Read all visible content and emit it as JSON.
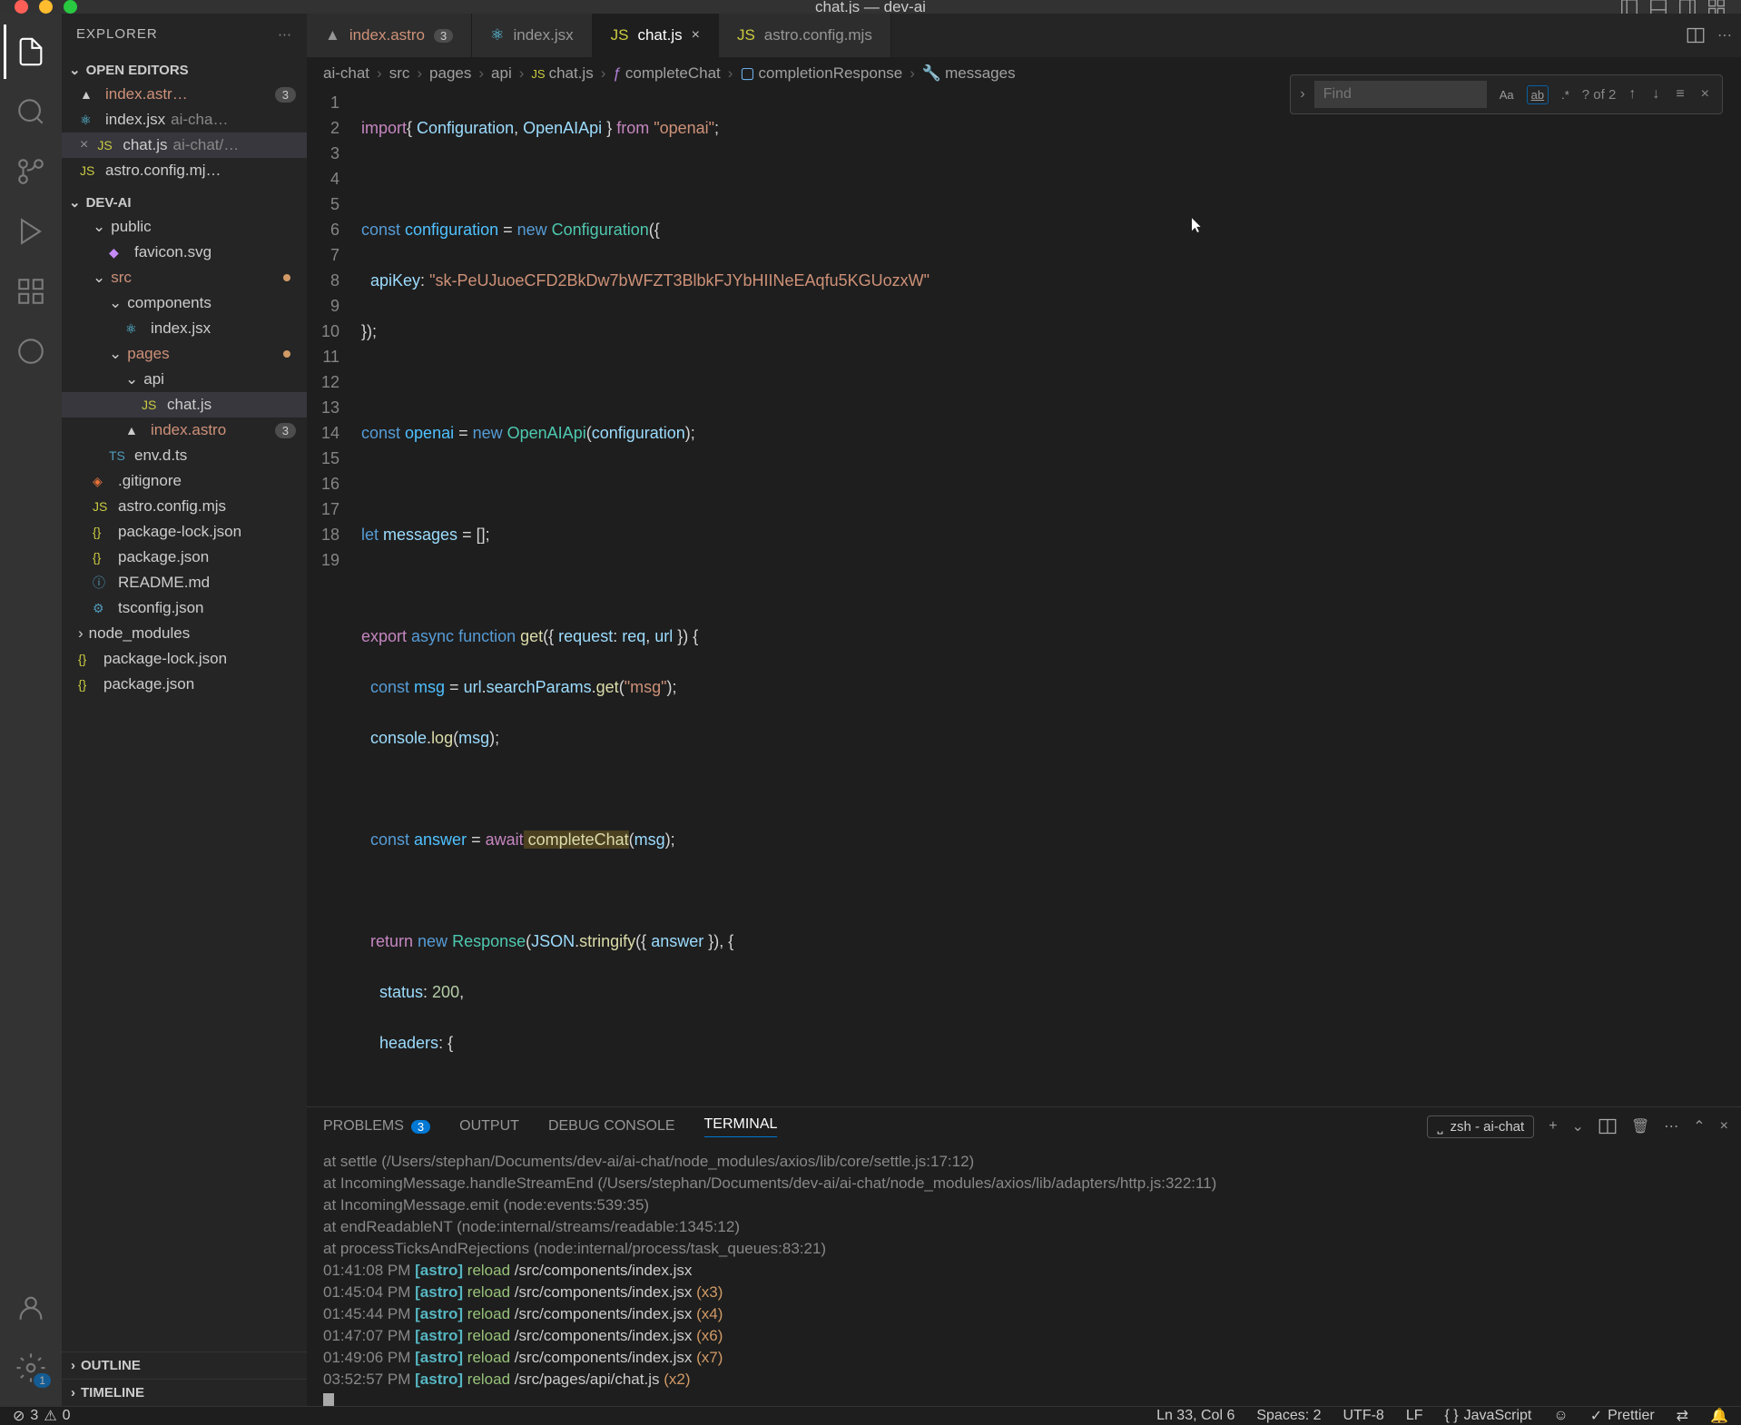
{
  "window": {
    "title": "chat.js — dev-ai"
  },
  "sidebar": {
    "header": "EXPLORER",
    "sections": {
      "open_editors": "OPEN EDITORS",
      "project": "DEV-AI",
      "outline": "OUTLINE",
      "timeline": "TIMELINE"
    },
    "open_editors": [
      {
        "name": "index.astr…",
        "badge": "3"
      },
      {
        "name": "index.jsx",
        "hint": "ai-cha…"
      },
      {
        "name": "chat.js",
        "hint": "ai-chat/…"
      },
      {
        "name": "astro.config.mj…"
      }
    ],
    "tree": {
      "public": "public",
      "favicon": "favicon.svg",
      "src": "src",
      "components": "components",
      "index_jsx": "index.jsx",
      "pages": "pages",
      "api": "api",
      "chat_js": "chat.js",
      "index_astro": "index.astro",
      "index_astro_badge": "3",
      "env_dts": "env.d.ts",
      "gitignore": ".gitignore",
      "astro_config": "astro.config.mjs",
      "pkg_lock": "package-lock.json",
      "pkg": "package.json",
      "readme": "README.md",
      "tsconfig": "tsconfig.json",
      "node_modules": "node_modules",
      "pkg_lock2": "package-lock.json",
      "pkg2": "package.json"
    }
  },
  "tabs": [
    {
      "name": "index.astro",
      "badge": "3"
    },
    {
      "name": "index.jsx"
    },
    {
      "name": "chat.js"
    },
    {
      "name": "astro.config.mjs"
    }
  ],
  "breadcrumbs": [
    "ai-chat",
    "src",
    "pages",
    "api",
    "chat.js",
    "completeChat",
    "completionResponse",
    "messages"
  ],
  "find": {
    "placeholder": "Find",
    "count": "? of 2"
  },
  "code": {
    "line1": {
      "a": "import",
      "b": "{ ",
      "c": "Configuration",
      "d": ", ",
      "e": "OpenAIApi",
      "f": " } ",
      "g": "from",
      "h": " \"openai\"",
      "i": ";"
    },
    "line3": {
      "a": "const",
      "b": " configuration ",
      "c": "=",
      "d": " new",
      "e": " Configuration",
      "f": "({"
    },
    "line4": {
      "a": "  apiKey",
      "b": ": ",
      "c": "\"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\""
    },
    "line5": "});",
    "line7": {
      "a": "const",
      "b": " openai ",
      "c": "=",
      "d": " new",
      "e": " OpenAIApi",
      "f": "(",
      "g": "configuration",
      "h": ");"
    },
    "line9": {
      "a": "let",
      "b": " messages ",
      "c": "=",
      "d": " [];"
    },
    "line11": {
      "a": "export",
      "b": " async",
      "c": " function",
      "d": " get",
      "e": "({ ",
      "f": "request",
      "g": ": ",
      "h": "req",
      "i": ", ",
      "j": "url",
      "k": " }) {"
    },
    "line12": {
      "a": "  const",
      "b": " msg ",
      "c": "=",
      "d": " url",
      "e": ".",
      "f": "searchParams",
      "g": ".",
      "h": "get",
      "i": "(",
      "j": "\"msg\"",
      "k": ");"
    },
    "line13": {
      "a": "  console",
      "b": ".",
      "c": "log",
      "d": "(",
      "e": "msg",
      "f": ");"
    },
    "line15": {
      "a": "  const",
      "b": " answer ",
      "c": "=",
      "d": " await",
      "e": " completeChat",
      "f": "(",
      "g": "msg",
      "h": ");"
    },
    "line17": {
      "a": "  return",
      "b": " new",
      "c": " Response",
      "d": "(",
      "e": "JSON",
      "f": ".",
      "g": "stringify",
      "h": "({ ",
      "i": "answer",
      "j": " }), {"
    },
    "line18": {
      "a": "    status",
      "b": ": ",
      "c": "200",
      "d": ","
    },
    "line19": {
      "a": "    headers",
      "b": ": {"
    }
  },
  "panel": {
    "tabs": {
      "problems": "PROBLEMS",
      "problems_count": "3",
      "output": "OUTPUT",
      "debug": "DEBUG CONSOLE",
      "terminal": "TERMINAL"
    },
    "term_label": "zsh - ai-chat",
    "lines": [
      "    at settle (/Users/stephan/Documents/dev-ai/ai-chat/node_modules/axios/lib/core/settle.js:17:12)",
      "    at IncomingMessage.handleStreamEnd (/Users/stephan/Documents/dev-ai/ai-chat/node_modules/axios/lib/adapters/http.js:322:11)",
      "    at IncomingMessage.emit (node:events:539:35)",
      "    at endReadableNT (node:internal/streams/readable:1345:12)",
      "    at processTicksAndRejections (node:internal/process/task_queues:83:21)"
    ],
    "reloads": [
      {
        "time": "01:41:08 PM",
        "tag": "[astro]",
        "action": "reload",
        "path": "/src/components/index.jsx",
        "suffix": ""
      },
      {
        "time": "01:45:04 PM",
        "tag": "[astro]",
        "action": "reload",
        "path": "/src/components/index.jsx",
        "suffix": " (x3)"
      },
      {
        "time": "01:45:44 PM",
        "tag": "[astro]",
        "action": "reload",
        "path": "/src/components/index.jsx",
        "suffix": " (x4)"
      },
      {
        "time": "01:47:07 PM",
        "tag": "[astro]",
        "action": "reload",
        "path": "/src/components/index.jsx",
        "suffix": " (x6)"
      },
      {
        "time": "01:49:06 PM",
        "tag": "[astro]",
        "action": "reload",
        "path": "/src/components/index.jsx",
        "suffix": " (x7)"
      },
      {
        "time": "03:52:57 PM",
        "tag": "[astro]",
        "action": "reload",
        "path": "/src/pages/api/chat.js",
        "suffix": " (x2)"
      }
    ]
  },
  "statusbar": {
    "errors": "3",
    "warnings": "0",
    "ln_col": "Ln 33, Col 6",
    "spaces": "Spaces: 2",
    "encoding": "UTF-8",
    "eol": "LF",
    "lang": "JavaScript",
    "prettier": "Prettier"
  }
}
